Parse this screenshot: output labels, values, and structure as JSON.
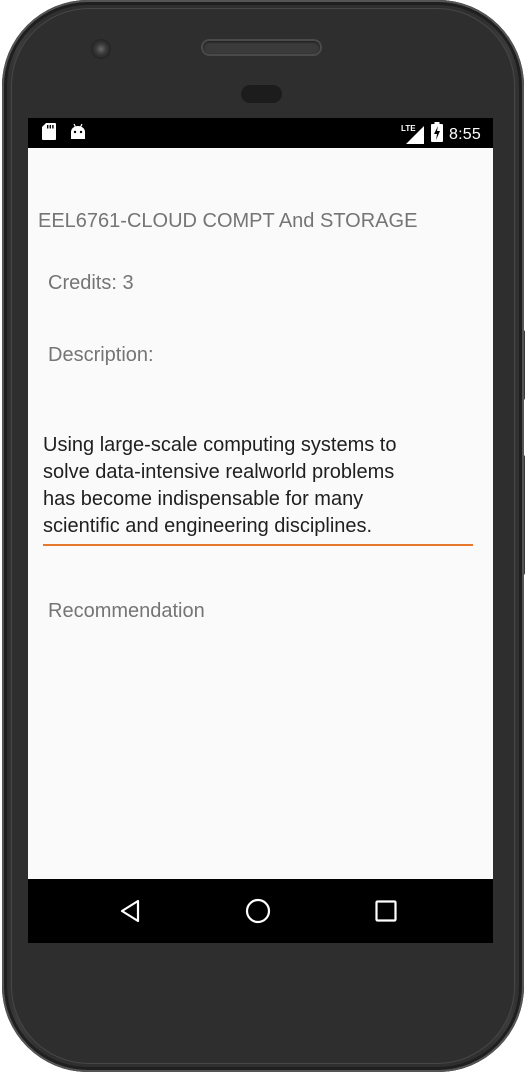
{
  "status_bar": {
    "time": "8:55",
    "network": "LTE",
    "icons": [
      "sd-card-icon",
      "android-icon",
      "signal-icon",
      "battery-icon"
    ]
  },
  "course": {
    "title": "EEL6761-CLOUD COMPT And STORAGE",
    "credits_label": "Credits: 3",
    "description_label": "Description:",
    "description_text": "Using large-scale computing systems to\nsolve data-intensive realworld problems\nhas become indispensable for many\nscientific and engineering disciplines.",
    "recommendation_label": "Recommendation"
  },
  "nav_bar": {
    "buttons": [
      "back-icon",
      "home-icon",
      "recents-icon"
    ]
  },
  "colors": {
    "accent": "#e8772e",
    "label_text": "#757575",
    "body_text": "#1f1f1f",
    "screen_bg": "#fafafa"
  }
}
